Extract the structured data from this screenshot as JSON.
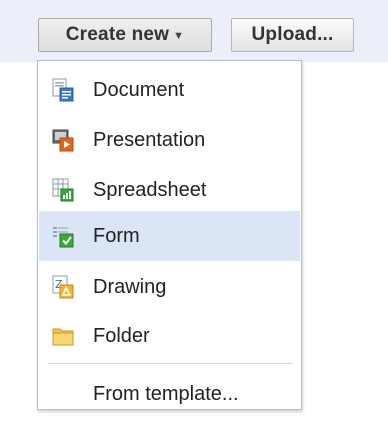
{
  "toolbar": {
    "create_label": "Create new",
    "upload_label": "Upload..."
  },
  "menu": {
    "items": [
      {
        "label": "Document",
        "icon": "document-icon"
      },
      {
        "label": "Presentation",
        "icon": "presentation-icon"
      },
      {
        "label": "Spreadsheet",
        "icon": "spreadsheet-icon"
      },
      {
        "label": "Form",
        "icon": "form-icon",
        "selected": true
      },
      {
        "label": "Drawing",
        "icon": "drawing-icon"
      },
      {
        "label": "Folder",
        "icon": "folder-icon"
      }
    ],
    "template_label": "From template..."
  },
  "colors": {
    "toolbar_bg": "#eceff9",
    "highlight": "#dbe5f5"
  }
}
